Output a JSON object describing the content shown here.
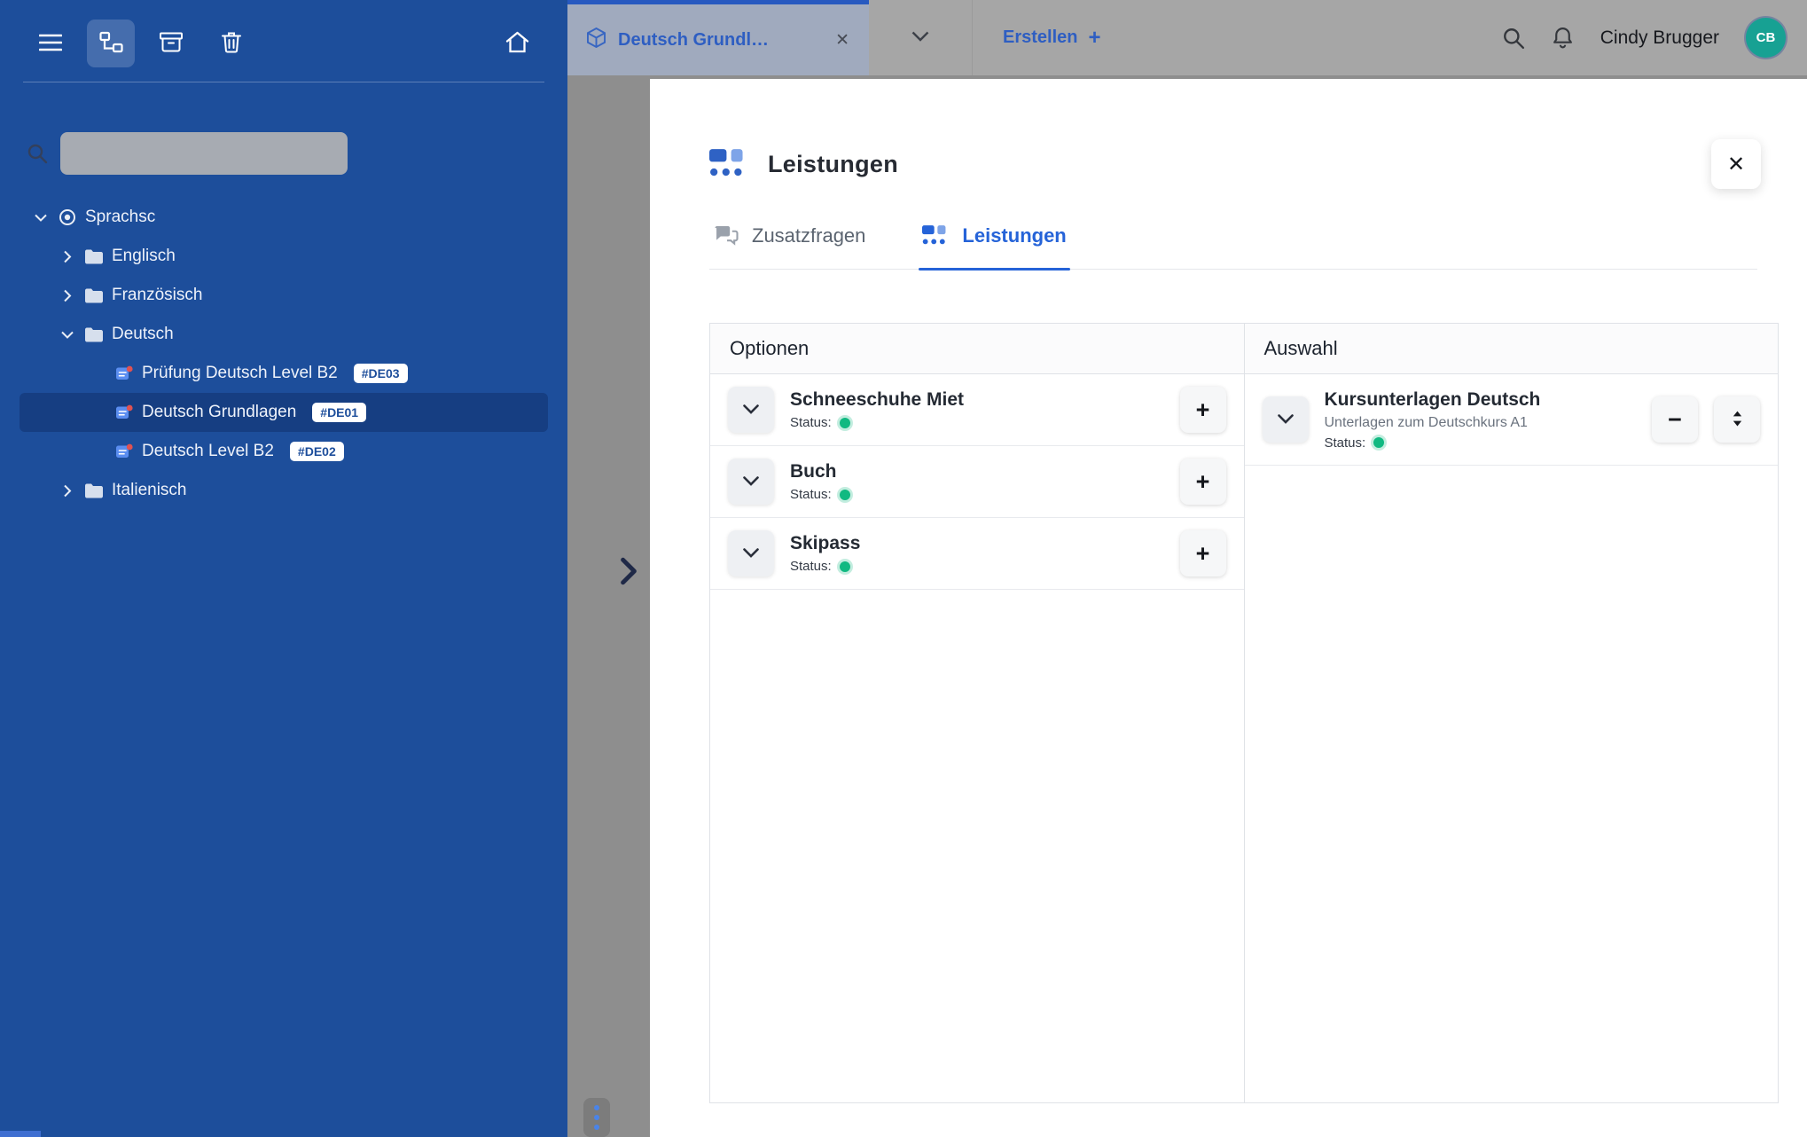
{
  "colors": {
    "sidebar_bg": "#1d4e9b",
    "sidebar_selected_bg": "#163e82",
    "accent_blue": "#2563d8",
    "status_green": "#10b981",
    "avatar_teal": "#17a193"
  },
  "glyphs": {
    "close": "✕",
    "plus": "+",
    "minus": "−"
  },
  "sidebar": {
    "search": {
      "placeholder": ""
    },
    "tree": [
      {
        "label": "Sprachsc"
      },
      {
        "label": "Englisch"
      },
      {
        "label": "Französisch"
      },
      {
        "label": "Deutsch"
      },
      {
        "label": "Prüfung Deutsch Level B2",
        "badge": "#DE03"
      },
      {
        "label": "Deutsch Grundlagen",
        "badge": "#DE01"
      },
      {
        "label": "Deutsch Level B2",
        "badge": "#DE02"
      },
      {
        "label": "Italienisch"
      }
    ]
  },
  "topbar": {
    "active_tab": {
      "label": "Deutsch Grundl…"
    },
    "create_button": {
      "label": "Erstellen",
      "plus": "+"
    },
    "user": {
      "name": "Cindy Brugger",
      "initials": "CB"
    }
  },
  "panel": {
    "title": "Leistungen",
    "tabs": [
      {
        "label": "Zusatzfragen"
      },
      {
        "label": "Leistungen"
      }
    ],
    "columns": {
      "options": {
        "header": "Optionen",
        "items": [
          {
            "title": "Schneeschuhe Miet",
            "status_label": "Status:"
          },
          {
            "title": "Buch",
            "status_label": "Status:"
          },
          {
            "title": "Skipass",
            "status_label": "Status:"
          }
        ]
      },
      "selection": {
        "header": "Auswahl",
        "items": [
          {
            "title": "Kursunterlagen Deutsch",
            "subtitle": "Unterlagen zum Deutschkurs A1",
            "status_label": "Status:"
          }
        ]
      }
    }
  }
}
